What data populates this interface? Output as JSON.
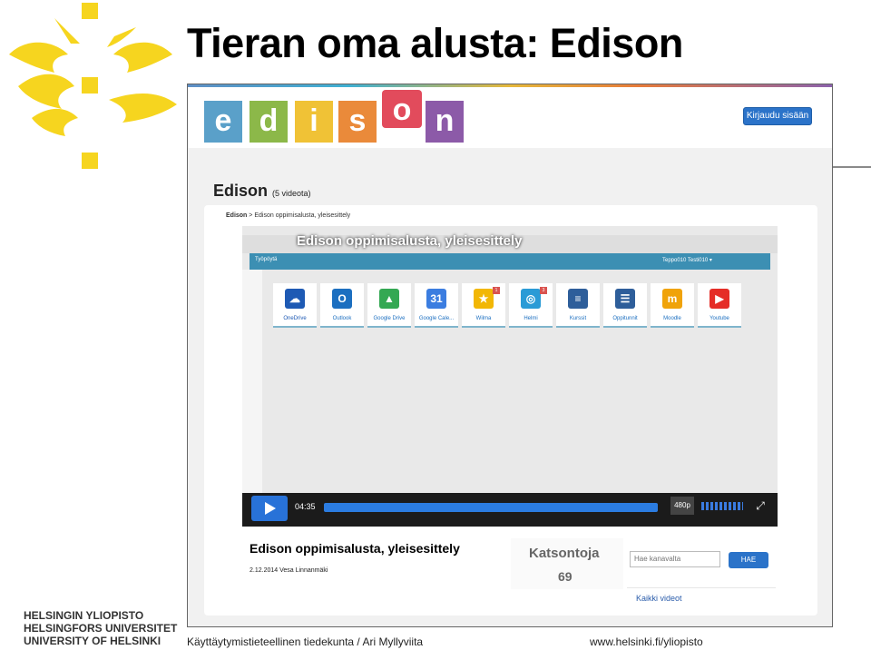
{
  "slide": {
    "title": "Tieran oma alusta: Edison",
    "footer_left": "Käyttäytymistieteellinen tiedekunta / Ari Myllyviita",
    "footer_right": "www.helsinki.fi/yliopisto",
    "university_lines": [
      "HELSINGIN YLIOPISTO",
      "HELSINGFORS UNIVERSITET",
      "UNIVERSITY OF HELSINKI"
    ],
    "colors": {
      "flame": "#f6d51f"
    }
  },
  "edison": {
    "logo_letters": [
      "e",
      "d",
      "i",
      "s",
      "o",
      "n"
    ],
    "logo_colors": [
      "#5aa0c9",
      "#8cb849",
      "#f0c236",
      "#ea8a3a",
      "#e24b5c",
      "#8c5aa8"
    ],
    "login_button": "Kirjaudu sisään",
    "page_title": "Edison",
    "video_count": "(5 videota)",
    "breadcrumb": {
      "home": "Edison",
      "separator": ">",
      "current": "Edison oppimisalusta, yleisesittely"
    },
    "video": {
      "overlay_title": "Edison oppimisalusta, yleisesittely",
      "app_nav_left": "Työpöytä",
      "app_nav_right": "Teppo010 Testi010 ▾",
      "time": "04:35",
      "quality": "480p",
      "progress_fraction": 1.0,
      "tiles": [
        {
          "label": "OneDrive",
          "glyph": "☁",
          "color": "#1e5ab4"
        },
        {
          "label": "Outlook",
          "glyph": "O",
          "color": "#1c6fc0"
        },
        {
          "label": "Google Drive",
          "glyph": "▲",
          "color": "#34a853"
        },
        {
          "label": "Google Cale...",
          "glyph": "31",
          "color": "#3b7de0"
        },
        {
          "label": "Wilma",
          "glyph": "★",
          "color": "#f2b705",
          "badge": "1"
        },
        {
          "label": "Helmi",
          "glyph": "◎",
          "color": "#2a9bd6",
          "badge": "3"
        },
        {
          "label": "Kurssit",
          "glyph": "≡",
          "color": "#2e5e9a"
        },
        {
          "label": "Oppitunnit",
          "glyph": "☰",
          "color": "#2e5e9a"
        },
        {
          "label": "Moodle",
          "glyph": "m",
          "color": "#f0a30a"
        },
        {
          "label": "Youtube",
          "glyph": "▶",
          "color": "#e52d27"
        }
      ]
    },
    "video_name": "Edison oppimisalusta, yleisesittely",
    "video_meta": "2.12.2014 Vesa Linnanmäki",
    "views_label": "Katsontoja",
    "views_count": "69",
    "search_placeholder": "Hae kanavalta",
    "search_button": "HAE",
    "all_videos": "Kaikki videot"
  }
}
